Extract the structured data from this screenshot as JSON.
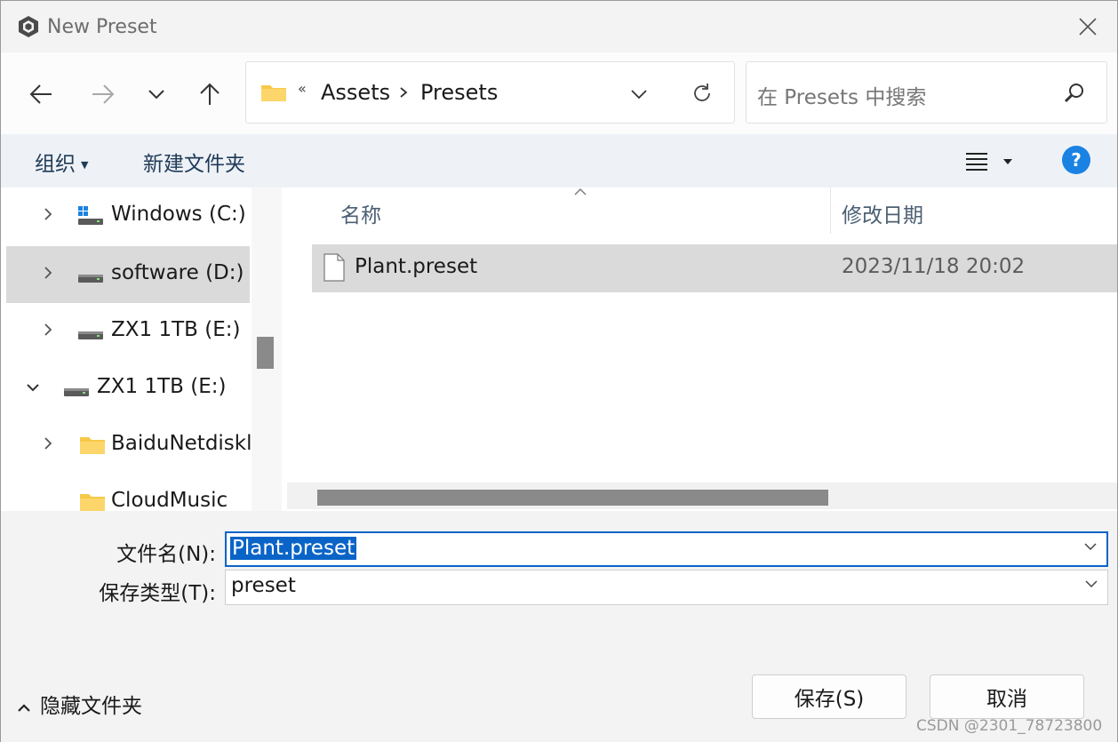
{
  "window": {
    "title": "New Preset"
  },
  "address": {
    "overflow": "«",
    "crumbs": [
      "Assets",
      "Presets"
    ]
  },
  "search": {
    "placeholder": "在 Presets 中搜索"
  },
  "commands": {
    "organize": "组织",
    "new_folder": "新建文件夹",
    "help": "?"
  },
  "nav_tree": {
    "items": [
      {
        "label": "Windows (C:)",
        "icon": "windows-drive-icon",
        "expanded": false,
        "selected": false
      },
      {
        "label": "software (D:)",
        "icon": "drive-icon",
        "expanded": false,
        "selected": true
      },
      {
        "label": "ZX1 1TB (E:)",
        "icon": "drive-icon",
        "expanded": false,
        "selected": false
      },
      {
        "label": "ZX1 1TB (E:)",
        "icon": "drive-icon",
        "expanded": true,
        "selected": false
      },
      {
        "label": "BaiduNetdiskl",
        "icon": "folder-icon",
        "expanded": false,
        "selected": false
      },
      {
        "label": "CloudMusic",
        "icon": "folder-icon",
        "expanded": false,
        "selected": false
      }
    ]
  },
  "file_list": {
    "columns": {
      "name": "名称",
      "modified": "修改日期"
    },
    "rows": [
      {
        "name": "Plant.preset",
        "modified": "2023/11/18 20:02",
        "icon": "file-icon",
        "selected": true
      }
    ]
  },
  "form": {
    "filename_label": "文件名(N):",
    "filename_value": "Plant.preset",
    "filetype_label": "保存类型(T):",
    "filetype_value": "preset"
  },
  "footer": {
    "hide_folders": "隐藏文件夹",
    "save": "保存(S)",
    "cancel": "取消"
  },
  "watermark": "CSDN @2301_78723800",
  "colors": {
    "accent": "#0a64c8",
    "help": "#1a82e2",
    "selection": "#dadada",
    "folder": "#f7c948"
  }
}
